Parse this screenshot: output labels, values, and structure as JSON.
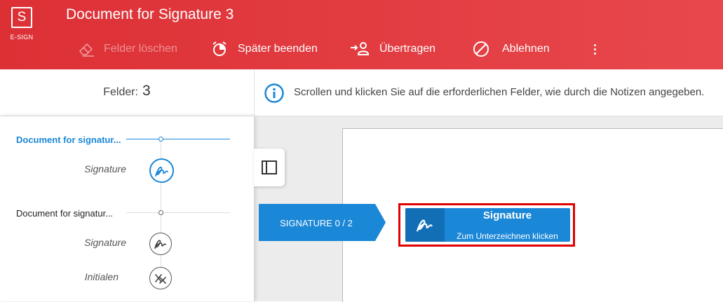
{
  "app": {
    "logo_letter": "S",
    "logo_text": "E-SIGN",
    "title": "Document for Signature 3"
  },
  "toolbar": {
    "clear_fields": "Felder löschen",
    "finish_later": "Später beenden",
    "transfer": "Übertragen",
    "decline": "Ablehnen"
  },
  "subbar": {
    "fields_label": "Felder:",
    "fields_count": "3",
    "info_text": "Scrollen und klicken Sie auf die erforderlichen Felder, wie durch die Notizen angegeben."
  },
  "sidebar": {
    "documents": [
      {
        "title": "Document for signatur...",
        "active": true,
        "fields": [
          {
            "label": "Signature",
            "icon": "signature-icon"
          }
        ]
      },
      {
        "title": "Document for signatur...",
        "active": false,
        "fields": [
          {
            "label": "Signature",
            "icon": "signature-icon"
          },
          {
            "label": "Initialen",
            "icon": "initials-icon"
          }
        ]
      }
    ]
  },
  "document": {
    "progress_label": "SIGNATURE 0 / 2",
    "signature_field": {
      "title": "Signature",
      "subtitle": "Zum Unterzeichnen klicken"
    }
  },
  "colors": {
    "header": "#e03a3f",
    "accent": "#1b87d7",
    "highlight": "#e00000"
  }
}
